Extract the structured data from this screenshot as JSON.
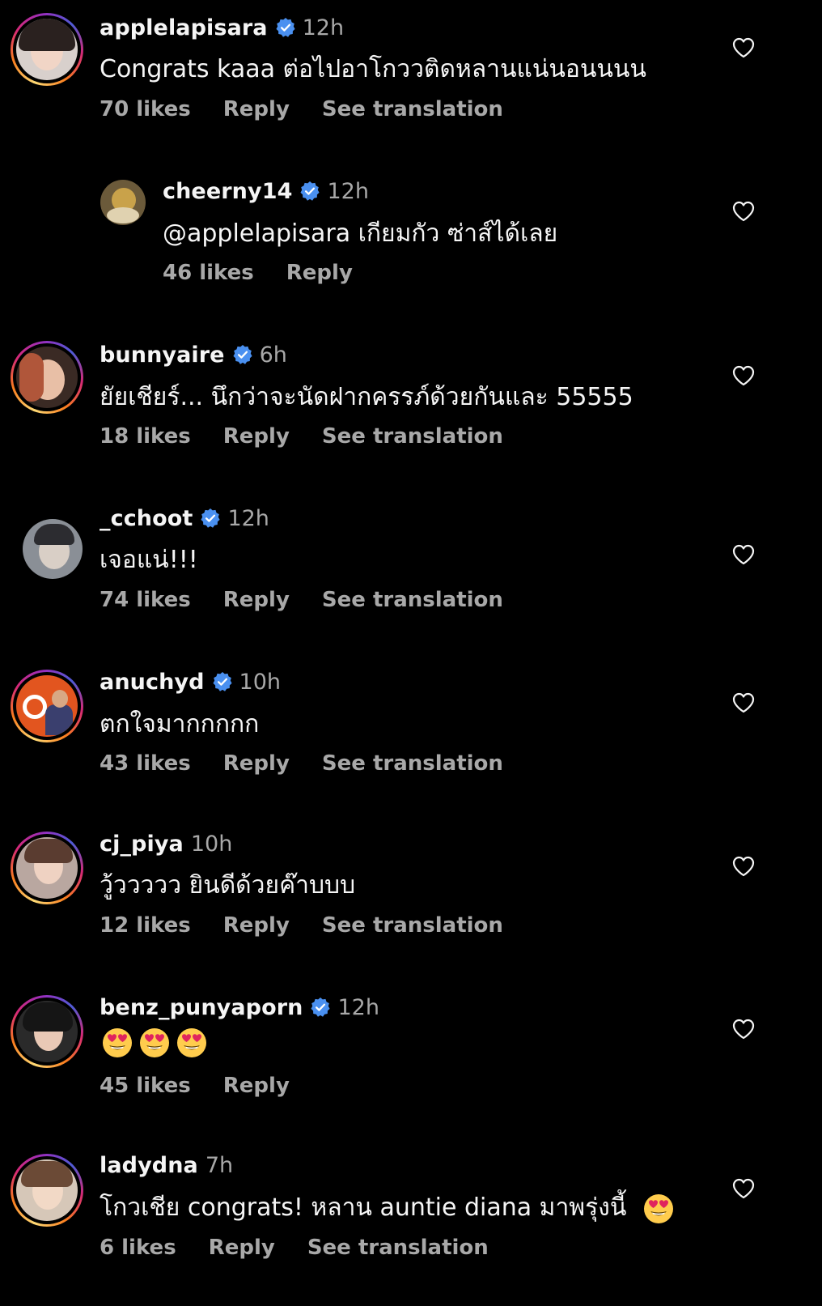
{
  "comments": [
    {
      "username": "applelapisara",
      "verified": true,
      "time": "12h",
      "text": "Congrats kaaa ต่อไปอาโกววติดหลานแน่นอนนนน",
      "likes": "70 likes",
      "reply": "Reply",
      "translate": "See translation"
    },
    {
      "username": "cheerny14",
      "verified": true,
      "time": "12h",
      "text": "@applelapisara เกียมกัว ซ่าส์ได้เลย",
      "likes": "46 likes",
      "reply": "Reply",
      "translate": ""
    },
    {
      "username": "bunnyaire",
      "verified": true,
      "time": "6h",
      "text": "ยัยเชียร์... นึกว่าจะนัดฝากครรภ์ด้วยกันและ 55555",
      "likes": "18 likes",
      "reply": "Reply",
      "translate": "See translation"
    },
    {
      "username": "_cchoot",
      "verified": true,
      "time": "12h",
      "text": "เจอแน่!!!",
      "likes": "74 likes",
      "reply": "Reply",
      "translate": "See translation"
    },
    {
      "username": "anuchyd",
      "verified": true,
      "time": "10h",
      "text": "ตกใจมากกกกก",
      "likes": "43 likes",
      "reply": "Reply",
      "translate": "See translation"
    },
    {
      "username": "cj_piya",
      "verified": false,
      "time": "10h",
      "text": "วู้ววววว ยินดีด้วยค๊าบบบ",
      "likes": "12 likes",
      "reply": "Reply",
      "translate": "See translation"
    },
    {
      "username": "benz_punyaporn",
      "verified": true,
      "time": "12h",
      "text": "",
      "likes": "45 likes",
      "reply": "Reply",
      "translate": ""
    },
    {
      "username": "ladydna",
      "verified": false,
      "time": "7h",
      "text": "โกวเชีย congrats! หลาน auntie diana มาพรุ่งนี้",
      "likes": "6 likes",
      "reply": "Reply",
      "translate": "See translation"
    }
  ],
  "icons": {
    "heart": "heart-outline-icon",
    "verified": "verified-badge-icon",
    "emoji": "heart-eyes-emoji"
  },
  "colors": {
    "background": "#000000",
    "primary_text": "#f5f5f5",
    "secondary_text": "#a8a8a8",
    "verified_blue": "#0095f6"
  }
}
